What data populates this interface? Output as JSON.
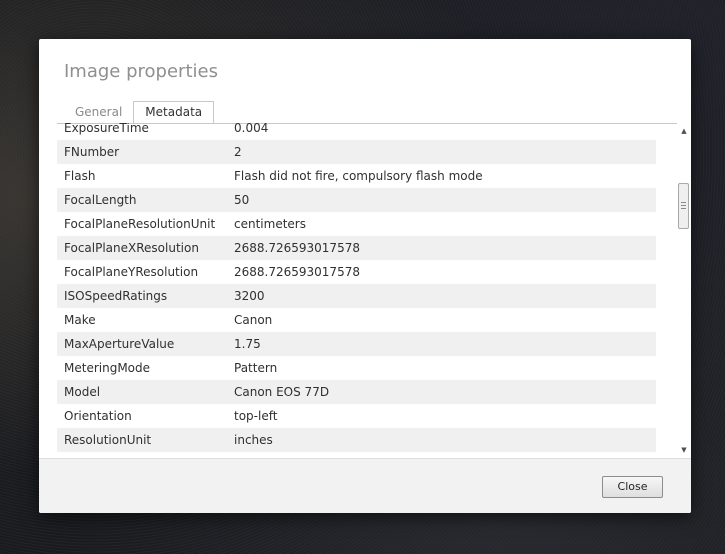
{
  "dialog": {
    "title": "Image properties",
    "tabs": [
      {
        "label": "General",
        "active": false
      },
      {
        "label": "Metadata",
        "active": true
      }
    ],
    "metadata_rows": [
      {
        "key": "ExposureTime",
        "value": "0.004"
      },
      {
        "key": "FNumber",
        "value": "2"
      },
      {
        "key": "Flash",
        "value": "Flash did not fire, compulsory flash mode"
      },
      {
        "key": "FocalLength",
        "value": "50"
      },
      {
        "key": "FocalPlaneResolutionUnit",
        "value": "centimeters"
      },
      {
        "key": "FocalPlaneXResolution",
        "value": "2688.726593017578"
      },
      {
        "key": "FocalPlaneYResolution",
        "value": "2688.726593017578"
      },
      {
        "key": "ISOSpeedRatings",
        "value": "3200"
      },
      {
        "key": "Make",
        "value": "Canon"
      },
      {
        "key": "MaxApertureValue",
        "value": "1.75"
      },
      {
        "key": "MeteringMode",
        "value": "Pattern"
      },
      {
        "key": "Model",
        "value": "Canon EOS 77D"
      },
      {
        "key": "Orientation",
        "value": "top-left"
      },
      {
        "key": "ResolutionUnit",
        "value": "inches"
      }
    ],
    "close_label": "Close"
  },
  "scrollbar": {
    "up_icon": "scroll-up-arrow-icon",
    "down_icon": "scroll-down-arrow-icon"
  }
}
